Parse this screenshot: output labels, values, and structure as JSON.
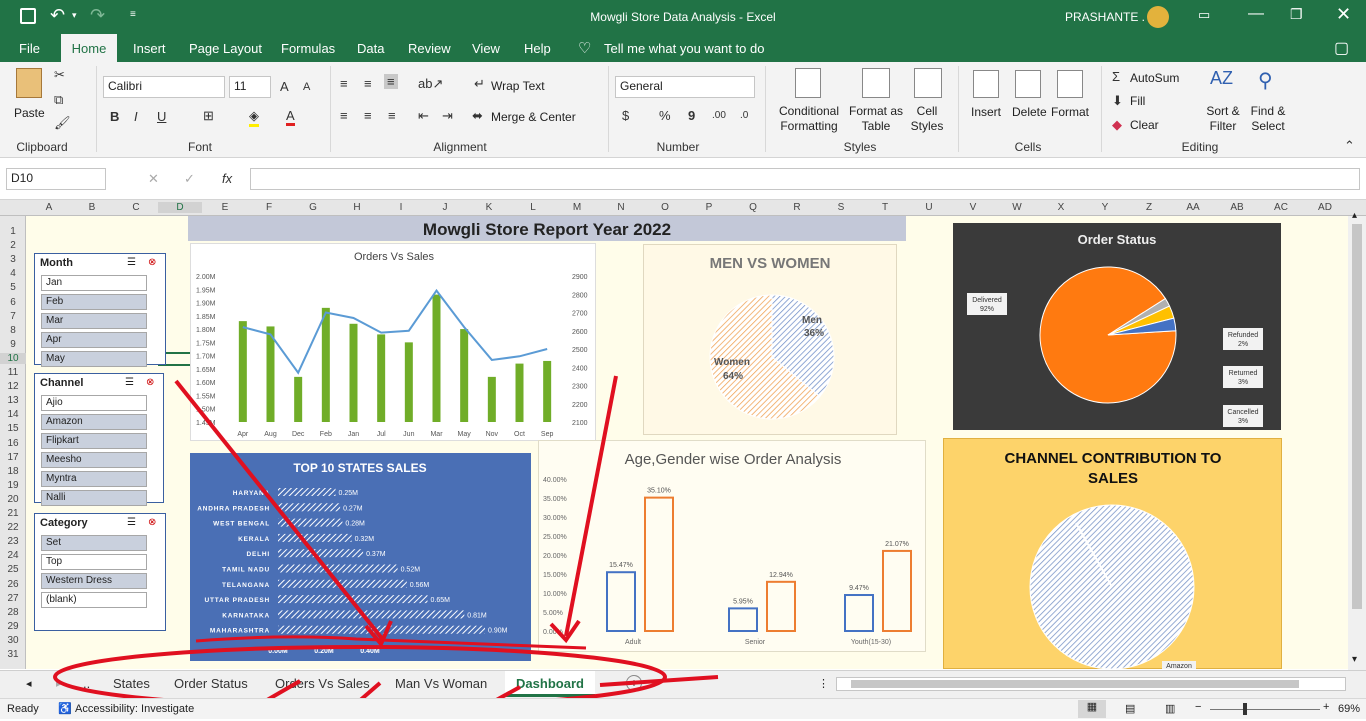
{
  "window": {
    "title": "Mowgli Store Data Analysis  -  Excel",
    "user": "PRASHANTE ."
  },
  "menu": [
    "File",
    "Home",
    "Insert",
    "Page Layout",
    "Formulas",
    "Data",
    "Review",
    "View",
    "Help"
  ],
  "tell_me": "Tell me what you want to do",
  "ribbon": {
    "paste": "Paste",
    "font_name": "Calibri",
    "font_size": "11",
    "wrap": "Wrap Text",
    "merge": "Merge & Center",
    "number_format": "General",
    "cond1": "Conditional",
    "cond2": "Formatting",
    "fat1": "Format as",
    "fat2": "Table",
    "cs1": "Cell",
    "cs2": "Styles",
    "insert": "Insert",
    "delete": "Delete",
    "format": "Format",
    "autosum": "AutoSum",
    "fill": "Fill",
    "clear": "Clear",
    "sort1": "Sort &",
    "sort2": "Filter",
    "find1": "Find &",
    "find2": "Select",
    "groups": {
      "clipboard": "Clipboard",
      "font": "Font",
      "alignment": "Alignment",
      "number": "Number",
      "styles": "Styles",
      "cells": "Cells",
      "editing": "Editing"
    }
  },
  "formula_bar": {
    "name_box": "D10",
    "fx": "fx",
    "value": ""
  },
  "columns": [
    "A",
    "B",
    "C",
    "D",
    "E",
    "F",
    "G",
    "H",
    "I",
    "J",
    "K",
    "L",
    "M",
    "N",
    "O",
    "P",
    "Q",
    "R",
    "S",
    "T",
    "U",
    "V",
    "W",
    "X",
    "Y",
    "Z",
    "AA",
    "AB",
    "AC",
    "AD"
  ],
  "rows": [
    "1",
    "2",
    "3",
    "4",
    "5",
    "6",
    "7",
    "8",
    "9",
    "10",
    "11",
    "12",
    "13",
    "14",
    "15",
    "16",
    "17",
    "18",
    "19",
    "20",
    "21",
    "22",
    "23",
    "24",
    "25",
    "26",
    "27",
    "28",
    "29",
    "30",
    "31"
  ],
  "dashboard": {
    "title": "Mowgli Store Report Year 2022",
    "slicers": {
      "month": {
        "title": "Month",
        "items": [
          "Jan",
          "Feb",
          "Mar",
          "Apr",
          "May"
        ],
        "selected": [
          false,
          true,
          true,
          true,
          true
        ]
      },
      "channel": {
        "title": "Channel",
        "items": [
          "Ajio",
          "Amazon",
          "Flipkart",
          "Meesho",
          "Myntra",
          "Nalli"
        ],
        "selected": [
          false,
          true,
          true,
          true,
          true,
          true
        ]
      },
      "category": {
        "title": "Category",
        "items": [
          "Set",
          "Top",
          "Western Dress",
          "(blank)"
        ],
        "selected": [
          true,
          false,
          true,
          false
        ]
      }
    }
  },
  "chart_data": [
    {
      "type": "bar",
      "title": "Orders Vs Sales",
      "categories": [
        "Apr",
        "Aug",
        "Dec",
        "Feb",
        "Jan",
        "Jul",
        "Jun",
        "Mar",
        "May",
        "Nov",
        "Oct",
        "Sep"
      ],
      "series": [
        {
          "name": "",
          "values": [
            1.83,
            1.81,
            1.62,
            1.88,
            1.82,
            1.78,
            1.75,
            1.93,
            1.8,
            1.62,
            1.67,
            1.68
          ]
        },
        {
          "name": "",
          "values": [
            2620,
            2580,
            2370,
            2700,
            2670,
            2590,
            2600,
            2820,
            2620,
            2440,
            2460,
            2500
          ]
        }
      ],
      "y_ticks": [
        "2.00M",
        "1.95M",
        "1.90M",
        "1.85M",
        "1.80M",
        "1.75M",
        "1.70M",
        "1.65M",
        "1.60M",
        "1.55M",
        "1.50M",
        "1.45M"
      ],
      "y2_ticks": [
        "2900",
        "2800",
        "2700",
        "2600",
        "2500",
        "2400",
        "2300",
        "2200",
        "2100"
      ],
      "ylim": [
        1.45,
        2.0
      ],
      "y2lim": [
        2100,
        2900
      ]
    },
    {
      "type": "pie",
      "title": "MEN VS WOMEN",
      "labels": [
        "Men",
        "Women"
      ],
      "values": [
        36,
        64
      ],
      "value_labels": [
        "36%",
        "64%"
      ]
    },
    {
      "type": "pie",
      "title": "Order Status",
      "labels": [
        "Delivered",
        "Refunded",
        "Returned",
        "Cancelled"
      ],
      "values": [
        92,
        2,
        3,
        3
      ],
      "value_labels": [
        "92%",
        "2%",
        "3%",
        "3%"
      ]
    },
    {
      "type": "bar",
      "title": "TOP 10 STATES SALES",
      "categories": [
        "HARYANA",
        "ANDHRA PRADESH",
        "WEST BENGAL",
        "KERALA",
        "DELHI",
        "TAMIL NADU",
        "TELANGANA",
        "UTTAR PRADESH",
        "KARNATAKA",
        "MAHARASHTRA"
      ],
      "values": [
        0.25,
        0.27,
        0.28,
        0.32,
        0.37,
        0.52,
        0.56,
        0.65,
        0.81,
        0.9
      ],
      "value_labels": [
        "0.25M",
        "0.27M",
        "0.28M",
        "0.32M",
        "0.37M",
        "0.52M",
        "0.56M",
        "0.65M",
        "0.81M",
        "0.90M"
      ],
      "x_ticks": [
        "0.00M",
        "0.20M",
        "0.40M"
      ],
      "xlim": [
        0,
        1.0
      ]
    },
    {
      "type": "bar",
      "title": "Age,Gender wise Order Analysis",
      "categories": [
        "Adult",
        "Senior",
        "Youth(15-30)"
      ],
      "series": [
        {
          "name": "",
          "values": [
            15.47,
            5.95,
            9.47
          ]
        },
        {
          "name": "",
          "values": [
            35.1,
            12.94,
            21.07
          ]
        }
      ],
      "value_labels": [
        [
          "15.47%",
          "5.95%",
          "9.47%"
        ],
        [
          "35.10%",
          "12.94%",
          "21.07%"
        ]
      ],
      "y_ticks": [
        "40.00%",
        "35.00%",
        "30.00%",
        "25.00%",
        "20.00%",
        "15.00%",
        "10.00%",
        "5.00%",
        "0.00%"
      ],
      "ylim": [
        0,
        40
      ]
    },
    {
      "type": "pie",
      "title": "CHANNEL CONTRIBUTION TO SALES",
      "labels": [
        "Amazon"
      ],
      "values": [
        100
      ]
    }
  ],
  "sheet_tabs": [
    "..",
    "States",
    "Order Status",
    "Orders Vs Sales",
    "Man Vs Woman",
    "Dashboard"
  ],
  "active_tab": "Dashboard",
  "status": {
    "ready": "Ready",
    "accessibility": "Accessibility: Investigate",
    "zoom": "69%"
  }
}
